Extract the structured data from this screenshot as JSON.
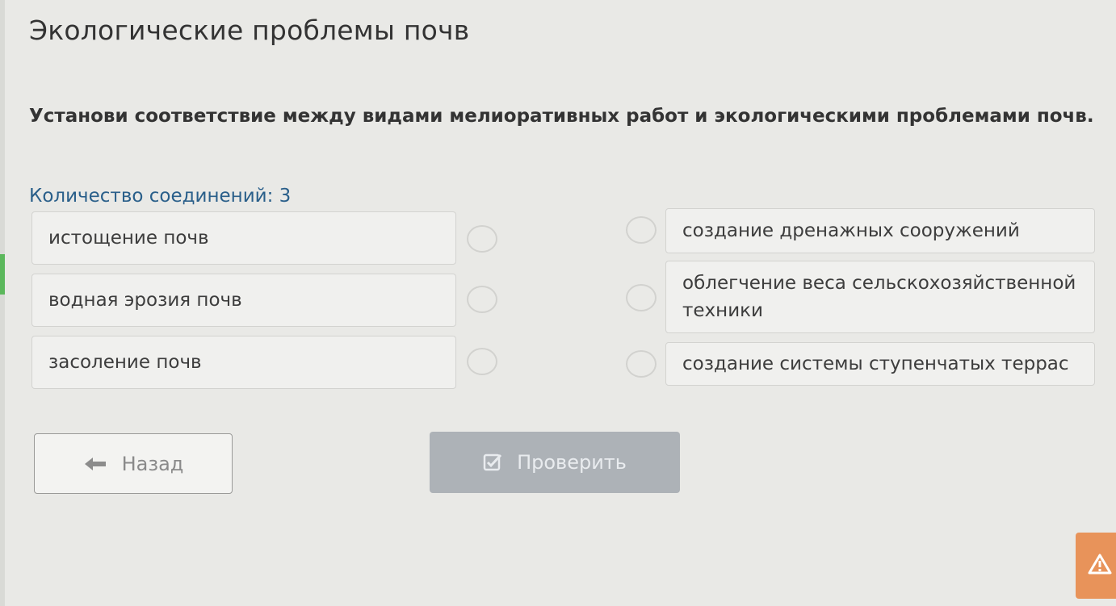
{
  "page": {
    "title": "Экологические проблемы почв",
    "question": "Установи соответствие между видами мелиоративных работ и экологическими проблемами почв.",
    "connections_label": "Количество соединений: 3"
  },
  "left_items": [
    {
      "label": "истощение почв"
    },
    {
      "label": "водная эрозия почв"
    },
    {
      "label": "засоление почв"
    }
  ],
  "right_items": [
    {
      "label": "создание дренажных сооружений"
    },
    {
      "label": "облегчение веса сельскохозяйственной техники"
    },
    {
      "label": "создание системы ступенчатых террас"
    }
  ],
  "buttons": {
    "back_label": "Назад",
    "check_label": "Проверить",
    "back_icon": "arrow-left-icon",
    "check_icon": "checkbox-checked-icon",
    "warning_icon": "warning-icon"
  },
  "colors": {
    "count_text": "#2a5f8a",
    "check_button_disabled": "#adb2b7",
    "warning_button": "#e8935a",
    "progress_marker": "#5cb85c"
  }
}
